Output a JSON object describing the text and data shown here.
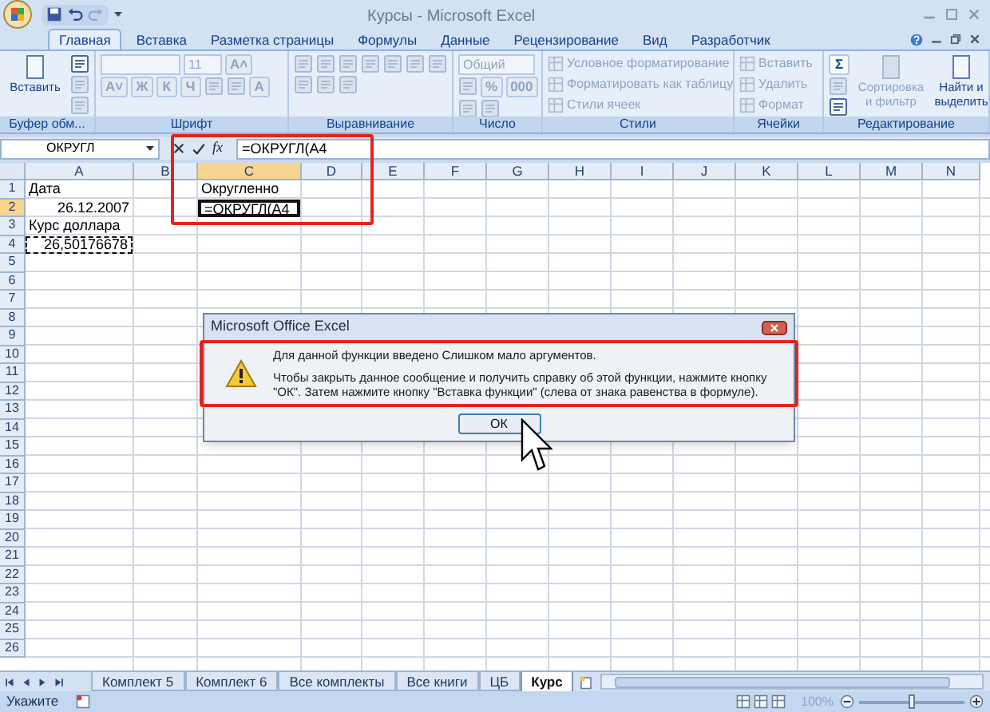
{
  "window": {
    "title": "Курсы - Microsoft Excel"
  },
  "ribbon_tabs": [
    {
      "label": "Главная",
      "selected": true
    },
    {
      "label": "Вставка",
      "selected": false
    },
    {
      "label": "Разметка страницы",
      "selected": false
    },
    {
      "label": "Формулы",
      "selected": false
    },
    {
      "label": "Данные",
      "selected": false
    },
    {
      "label": "Рецензирование",
      "selected": false
    },
    {
      "label": "Вид",
      "selected": false
    },
    {
      "label": "Разработчик",
      "selected": false
    }
  ],
  "ribbon_groups": [
    {
      "label": "Буфер обм...",
      "items": [
        {
          "kind": "large",
          "label": "Вставить",
          "disabled": false
        },
        {
          "kind": "icon",
          "disabled": false
        },
        {
          "kind": "icon",
          "disabled": true
        },
        {
          "kind": "icon",
          "disabled": true
        }
      ]
    },
    {
      "label": "Шрифт",
      "items": [
        {
          "kind": "field",
          "disabled": true
        },
        {
          "kind": "field",
          "value": "11",
          "disabled": true
        },
        {
          "kind": "glyph",
          "label": "A˄",
          "disabled": true
        },
        {
          "kind": "glyph",
          "label": "A˅",
          "disabled": true
        },
        {
          "kind": "glyph",
          "label": "Ж",
          "disabled": true
        },
        {
          "kind": "glyph",
          "label": "К",
          "disabled": true
        },
        {
          "kind": "glyph",
          "label": "Ч",
          "disabled": true
        },
        {
          "kind": "icon",
          "disabled": true
        },
        {
          "kind": "icon",
          "disabled": true
        },
        {
          "kind": "glyph",
          "label": "A",
          "disabled": true
        }
      ]
    },
    {
      "label": "Выравнивание",
      "items": [
        {
          "kind": "icon",
          "disabled": true
        },
        {
          "kind": "icon",
          "disabled": true
        },
        {
          "kind": "icon",
          "disabled": true
        },
        {
          "kind": "icon",
          "disabled": true
        },
        {
          "kind": "icon",
          "disabled": true
        },
        {
          "kind": "icon",
          "disabled": true
        },
        {
          "kind": "icon",
          "disabled": true
        },
        {
          "kind": "icon",
          "disabled": true
        },
        {
          "kind": "icon",
          "disabled": true
        },
        {
          "kind": "icon",
          "disabled": true
        }
      ]
    },
    {
      "label": "Число",
      "items": [
        {
          "kind": "field",
          "value": "Общий",
          "disabled": true
        },
        {
          "kind": "icon",
          "disabled": true
        },
        {
          "kind": "glyph",
          "label": "%",
          "disabled": true
        },
        {
          "kind": "glyph",
          "label": "000",
          "disabled": true
        },
        {
          "kind": "icon",
          "disabled": true
        },
        {
          "kind": "icon",
          "disabled": true
        }
      ]
    },
    {
      "label": "Стили",
      "items": [
        {
          "kind": "row",
          "label": "Условное форматирование",
          "disabled": true
        },
        {
          "kind": "row",
          "label": "Форматировать как таблицу",
          "disabled": true
        },
        {
          "kind": "row",
          "label": "Стили ячеек",
          "disabled": true
        }
      ]
    },
    {
      "label": "Ячейки",
      "items": [
        {
          "kind": "row",
          "label": "Вставить",
          "disabled": true
        },
        {
          "kind": "row",
          "label": "Удалить",
          "disabled": true
        },
        {
          "kind": "row",
          "label": "Формат",
          "disabled": true
        }
      ]
    },
    {
      "label": "Редактирование",
      "items": [
        {
          "kind": "glyph",
          "label": "Σ",
          "disabled": false
        },
        {
          "kind": "icon",
          "disabled": true
        },
        {
          "kind": "icon",
          "disabled": false
        },
        {
          "kind": "large",
          "label": "Сортировка и фильтр",
          "disabled": true
        },
        {
          "kind": "large",
          "label": "Найти и выделить",
          "disabled": false
        }
      ]
    }
  ],
  "formula_bar": {
    "name_box": "ОКРУГЛ",
    "fx": "fx",
    "formula": "=ОКРУГЛ(A4"
  },
  "columns": [
    {
      "label": "A",
      "selected": false
    },
    {
      "label": "B",
      "selected": false
    },
    {
      "label": "C",
      "selected": true
    },
    {
      "label": "D",
      "selected": false
    },
    {
      "label": "E",
      "selected": false
    },
    {
      "label": "F",
      "selected": false
    },
    {
      "label": "G",
      "selected": false
    },
    {
      "label": "H",
      "selected": false
    },
    {
      "label": "I",
      "selected": false
    },
    {
      "label": "J",
      "selected": false
    },
    {
      "label": "K",
      "selected": false
    },
    {
      "label": "L",
      "selected": false
    },
    {
      "label": "M",
      "selected": false
    },
    {
      "label": "N",
      "selected": false
    }
  ],
  "rows": [
    {
      "label": "1",
      "selected": false,
      "cells": {
        "A": {
          "text": "Дата",
          "right_aligned": false,
          "marquee": false,
          "editing": false
        },
        "C": {
          "text": "Округленно",
          "right_aligned": false,
          "marquee": false,
          "editing": false
        }
      }
    },
    {
      "label": "2",
      "selected": true,
      "cells": {
        "A": {
          "text": "26.12.2007",
          "right_aligned": true,
          "marquee": false,
          "editing": false
        },
        "C": {
          "text": "=ОКРУГЛ(A4",
          "right_aligned": false,
          "marquee": false,
          "editing": true
        }
      }
    },
    {
      "label": "3",
      "selected": false,
      "cells": {
        "A": {
          "text": "Курс доллара",
          "right_aligned": false,
          "marquee": false,
          "editing": false
        }
      }
    },
    {
      "label": "4",
      "selected": false,
      "cells": {
        "A": {
          "text": "26,50176678",
          "right_aligned": true,
          "marquee": true,
          "editing": false
        }
      }
    },
    {
      "label": "5",
      "selected": false
    },
    {
      "label": "6",
      "selected": false
    },
    {
      "label": "7",
      "selected": false
    },
    {
      "label": "8",
      "selected": false
    },
    {
      "label": "9",
      "selected": false
    },
    {
      "label": "10",
      "selected": false
    },
    {
      "label": "11",
      "selected": false
    },
    {
      "label": "12",
      "selected": false
    },
    {
      "label": "13",
      "selected": false
    },
    {
      "label": "14",
      "selected": false
    },
    {
      "label": "15",
      "selected": false
    },
    {
      "label": "16",
      "selected": false
    },
    {
      "label": "17",
      "selected": false
    },
    {
      "label": "18",
      "selected": false
    },
    {
      "label": "19",
      "selected": false
    },
    {
      "label": "20",
      "selected": false
    },
    {
      "label": "21",
      "selected": false
    },
    {
      "label": "22",
      "selected": false
    },
    {
      "label": "23",
      "selected": false
    },
    {
      "label": "24",
      "selected": false
    },
    {
      "label": "25",
      "selected": false
    },
    {
      "label": "26",
      "selected": false
    }
  ],
  "dialog": {
    "title": "Microsoft Office Excel",
    "messages": [
      "Для данной функции введено Слишком мало аргументов.",
      "Чтобы закрыть данное сообщение и получить справку об этой функции, нажмите кнопку \"ОК\". Затем нажмите кнопку \"Вставка функции\" (слева от знака равенства в формуле)."
    ],
    "button": "ОК"
  },
  "sheet_tabs": [
    {
      "label": "Комплект 5",
      "selected": false
    },
    {
      "label": "Комплект 6",
      "selected": false
    },
    {
      "label": "Все комплекты",
      "selected": false
    },
    {
      "label": "Все книги",
      "selected": false
    },
    {
      "label": "ЦБ",
      "selected": false
    },
    {
      "label": "Курс",
      "selected": true
    }
  ],
  "status_bar": {
    "mode": "Укажите",
    "zoom": "100%",
    "zoom_slider": {
      "level": 0.5
    }
  }
}
